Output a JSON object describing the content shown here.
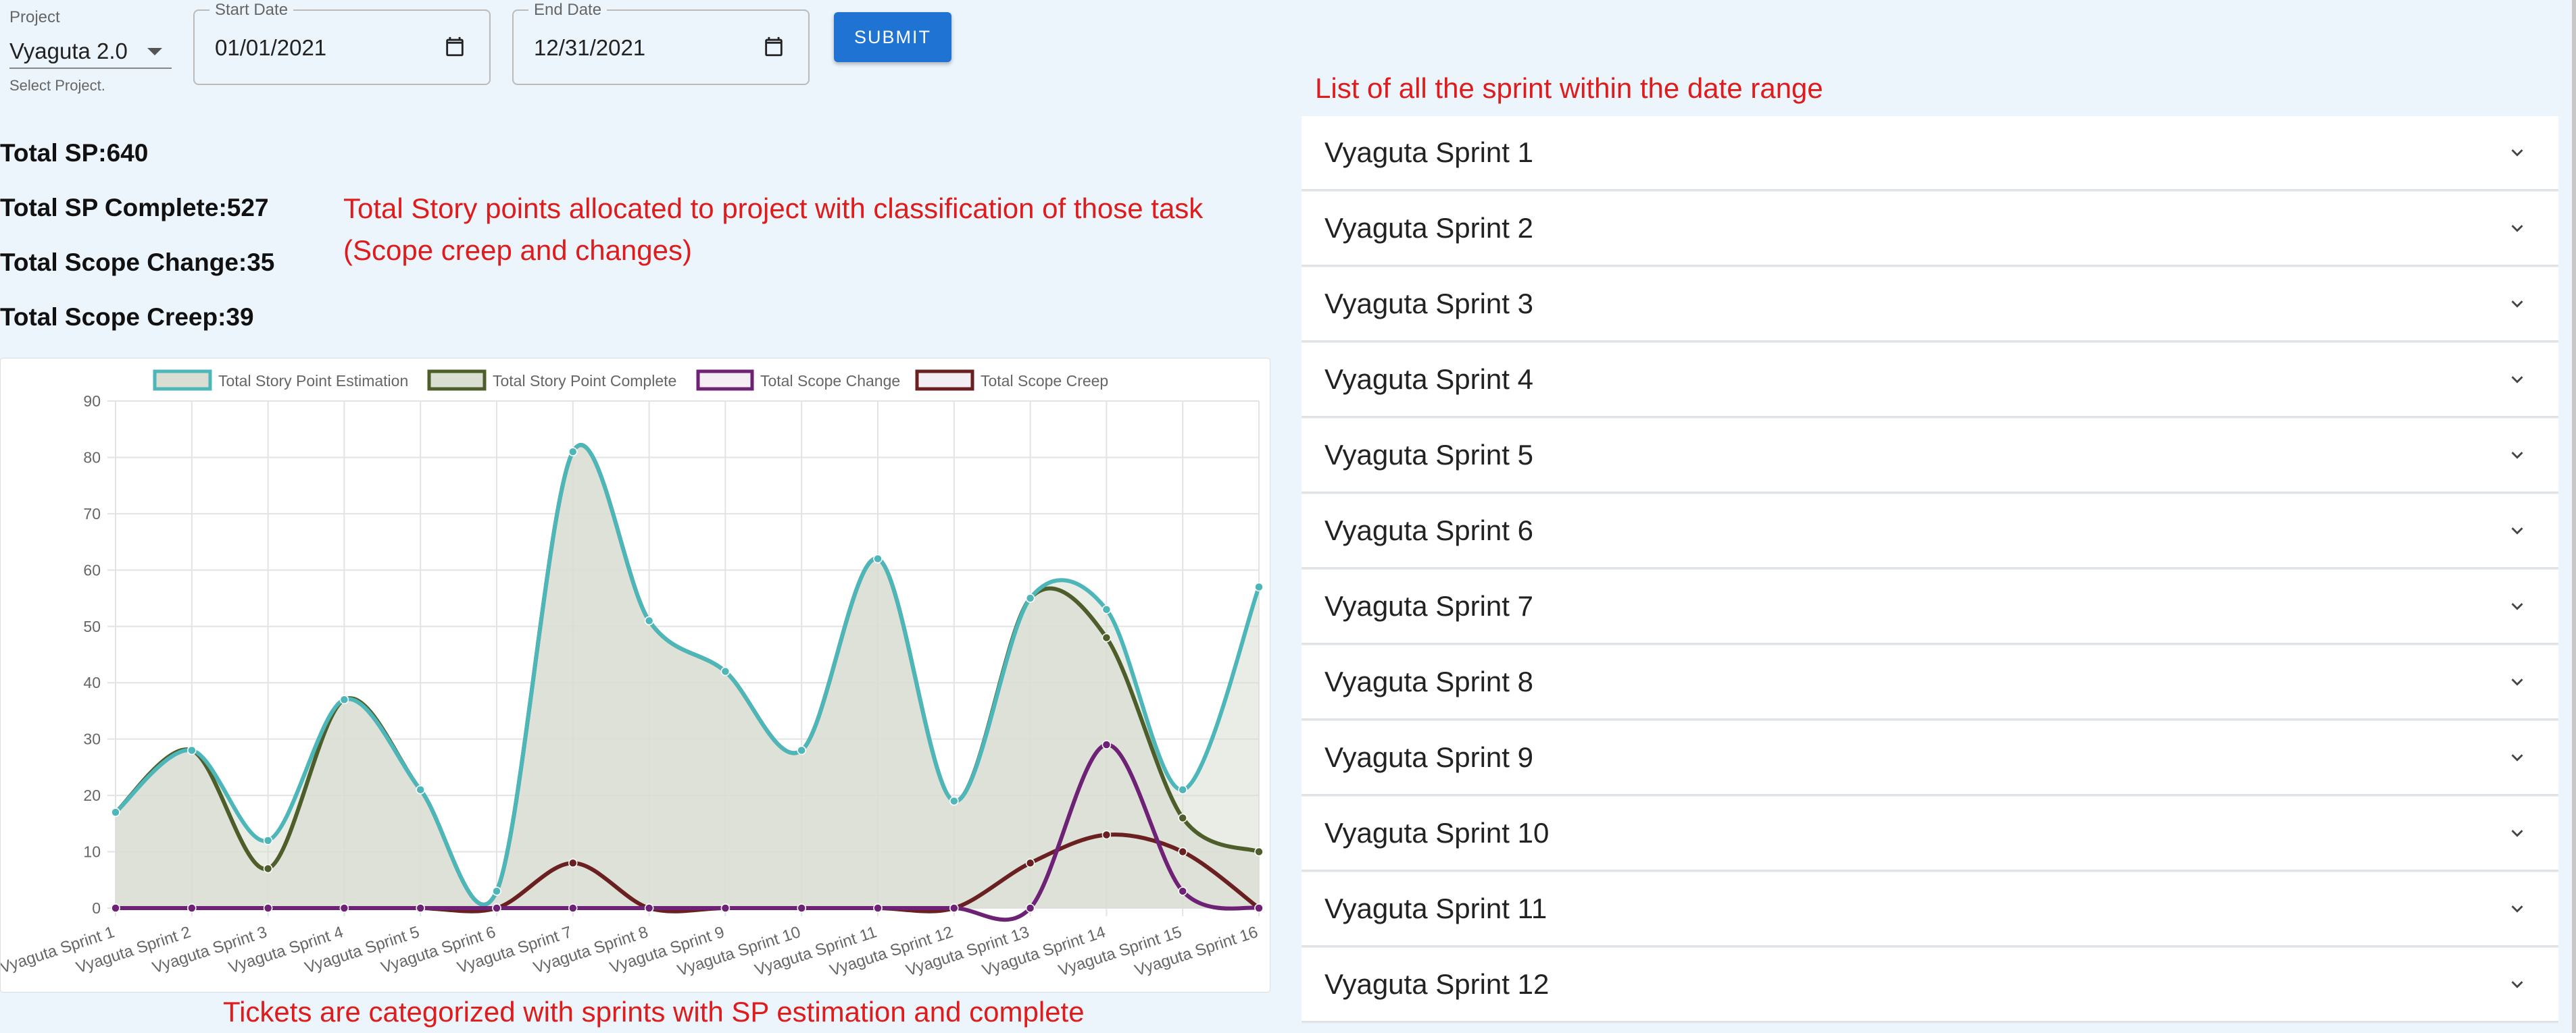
{
  "form": {
    "project_label": "Project",
    "project_value": "Vyaguta 2.0",
    "project_helper": "Select Project.",
    "start_label": "Start Date",
    "start_value": "01/01/2021",
    "end_label": "End Date",
    "end_value": "12/31/2021",
    "submit_label": "SUBMIT"
  },
  "stats": {
    "total_sp": "Total SP:640",
    "total_sp_complete": "Total SP Complete:527",
    "total_scope_change": "Total Scope Change:35",
    "total_scope_creep": "Total Scope Creep:39"
  },
  "annotations": {
    "sprint_list_note": "List of all the sprint within the date range",
    "story_points_note_line1": "Total Story points allocated to project with classification of those task",
    "story_points_note_line2": "(Scope creep and changes)",
    "chart_note": "Tickets are categorized with sprints with SP estimation and complete"
  },
  "colors": {
    "estimation": "#4db6b8",
    "complete": "#4d5e2a",
    "scope_change": "#6e2276",
    "scope_creep": "#6a2020",
    "fill": "#d9ddd2",
    "accent": "#1f73d2",
    "annotation": "#e01b1b"
  },
  "chart_data": {
    "type": "line",
    "categories": [
      "Vyaguta Sprint 1",
      "Vyaguta Sprint 2",
      "Vyaguta Sprint 3",
      "Vyaguta Sprint 4",
      "Vyaguta Sprint 5",
      "Vyaguta Sprint 6",
      "Vyaguta Sprint 7",
      "Vyaguta Sprint 8",
      "Vyaguta Sprint 9",
      "Vyaguta Sprint 10",
      "Vyaguta Sprint 11",
      "Vyaguta Sprint 12",
      "Vyaguta Sprint 13",
      "Vyaguta Sprint 14",
      "Vyaguta Sprint 15",
      "Vyaguta Sprint 16"
    ],
    "series": [
      {
        "name": "Total Story Point Estimation",
        "values": [
          17,
          28,
          12,
          37,
          21,
          3,
          81,
          51,
          42,
          28,
          62,
          19,
          55,
          53,
          21,
          57
        ]
      },
      {
        "name": "Total Story Point Complete",
        "values": [
          17,
          28,
          7,
          37,
          21,
          3,
          81,
          51,
          42,
          28,
          62,
          19,
          55,
          48,
          16,
          10
        ]
      },
      {
        "name": "Total Scope Change",
        "values": [
          0,
          0,
          0,
          0,
          0,
          0,
          0,
          0,
          0,
          0,
          0,
          0,
          0,
          29,
          3,
          0
        ]
      },
      {
        "name": "Total Scope Creep",
        "values": [
          0,
          0,
          0,
          0,
          0,
          0,
          8,
          0,
          0,
          0,
          0,
          0,
          8,
          13,
          10,
          0
        ]
      }
    ],
    "ylim": [
      0,
      90
    ],
    "yticks": [
      0,
      10,
      20,
      30,
      40,
      50,
      60,
      70,
      80,
      90
    ],
    "legend": "top",
    "grid": true
  },
  "sprints": [
    "Vyaguta Sprint 1",
    "Vyaguta Sprint 2",
    "Vyaguta Sprint 3",
    "Vyaguta Sprint 4",
    "Vyaguta Sprint 5",
    "Vyaguta Sprint 6",
    "Vyaguta Sprint 7",
    "Vyaguta Sprint 8",
    "Vyaguta Sprint 9",
    "Vyaguta Sprint 10",
    "Vyaguta Sprint 11",
    "Vyaguta Sprint 12"
  ]
}
